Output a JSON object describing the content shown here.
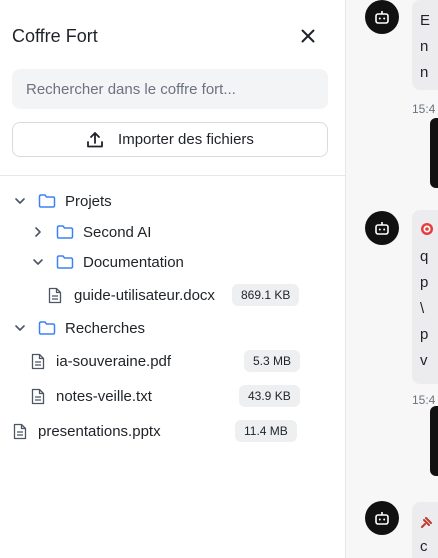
{
  "vault": {
    "title": "Coffre Fort",
    "search_placeholder": "Rechercher dans le coffre fort...",
    "import_label": "Importer des fichiers"
  },
  "tree": {
    "projets": "Projets",
    "second_ai": "Second AI",
    "documentation": "Documentation",
    "guide_name": "guide-utilisateur.docx",
    "guide_size": "869.1 KB",
    "recherches": "Recherches",
    "ia_name": "ia-souveraine.pdf",
    "ia_size": "5.3 MB",
    "notes_name": "notes-veille.txt",
    "notes_size": "43.9 KB",
    "pres_name": "presentations.pptx",
    "pres_size": "11.4 MB"
  },
  "chat": {
    "msg1_lines": [
      "E",
      "n",
      "n"
    ],
    "time1": "15:4",
    "msg2_lines": [
      "q",
      "p",
      "\\",
      "p",
      "v"
    ],
    "time2": "15:4",
    "msg3_lines": [
      "c"
    ]
  },
  "icons": {
    "close": "close-icon",
    "upload": "upload-icon",
    "folder": "folder-icon",
    "file": "file-icon",
    "bot": "bot-icon"
  },
  "colors": {
    "folder_blue": "#3b82f6",
    "bot_bg": "#111111"
  }
}
